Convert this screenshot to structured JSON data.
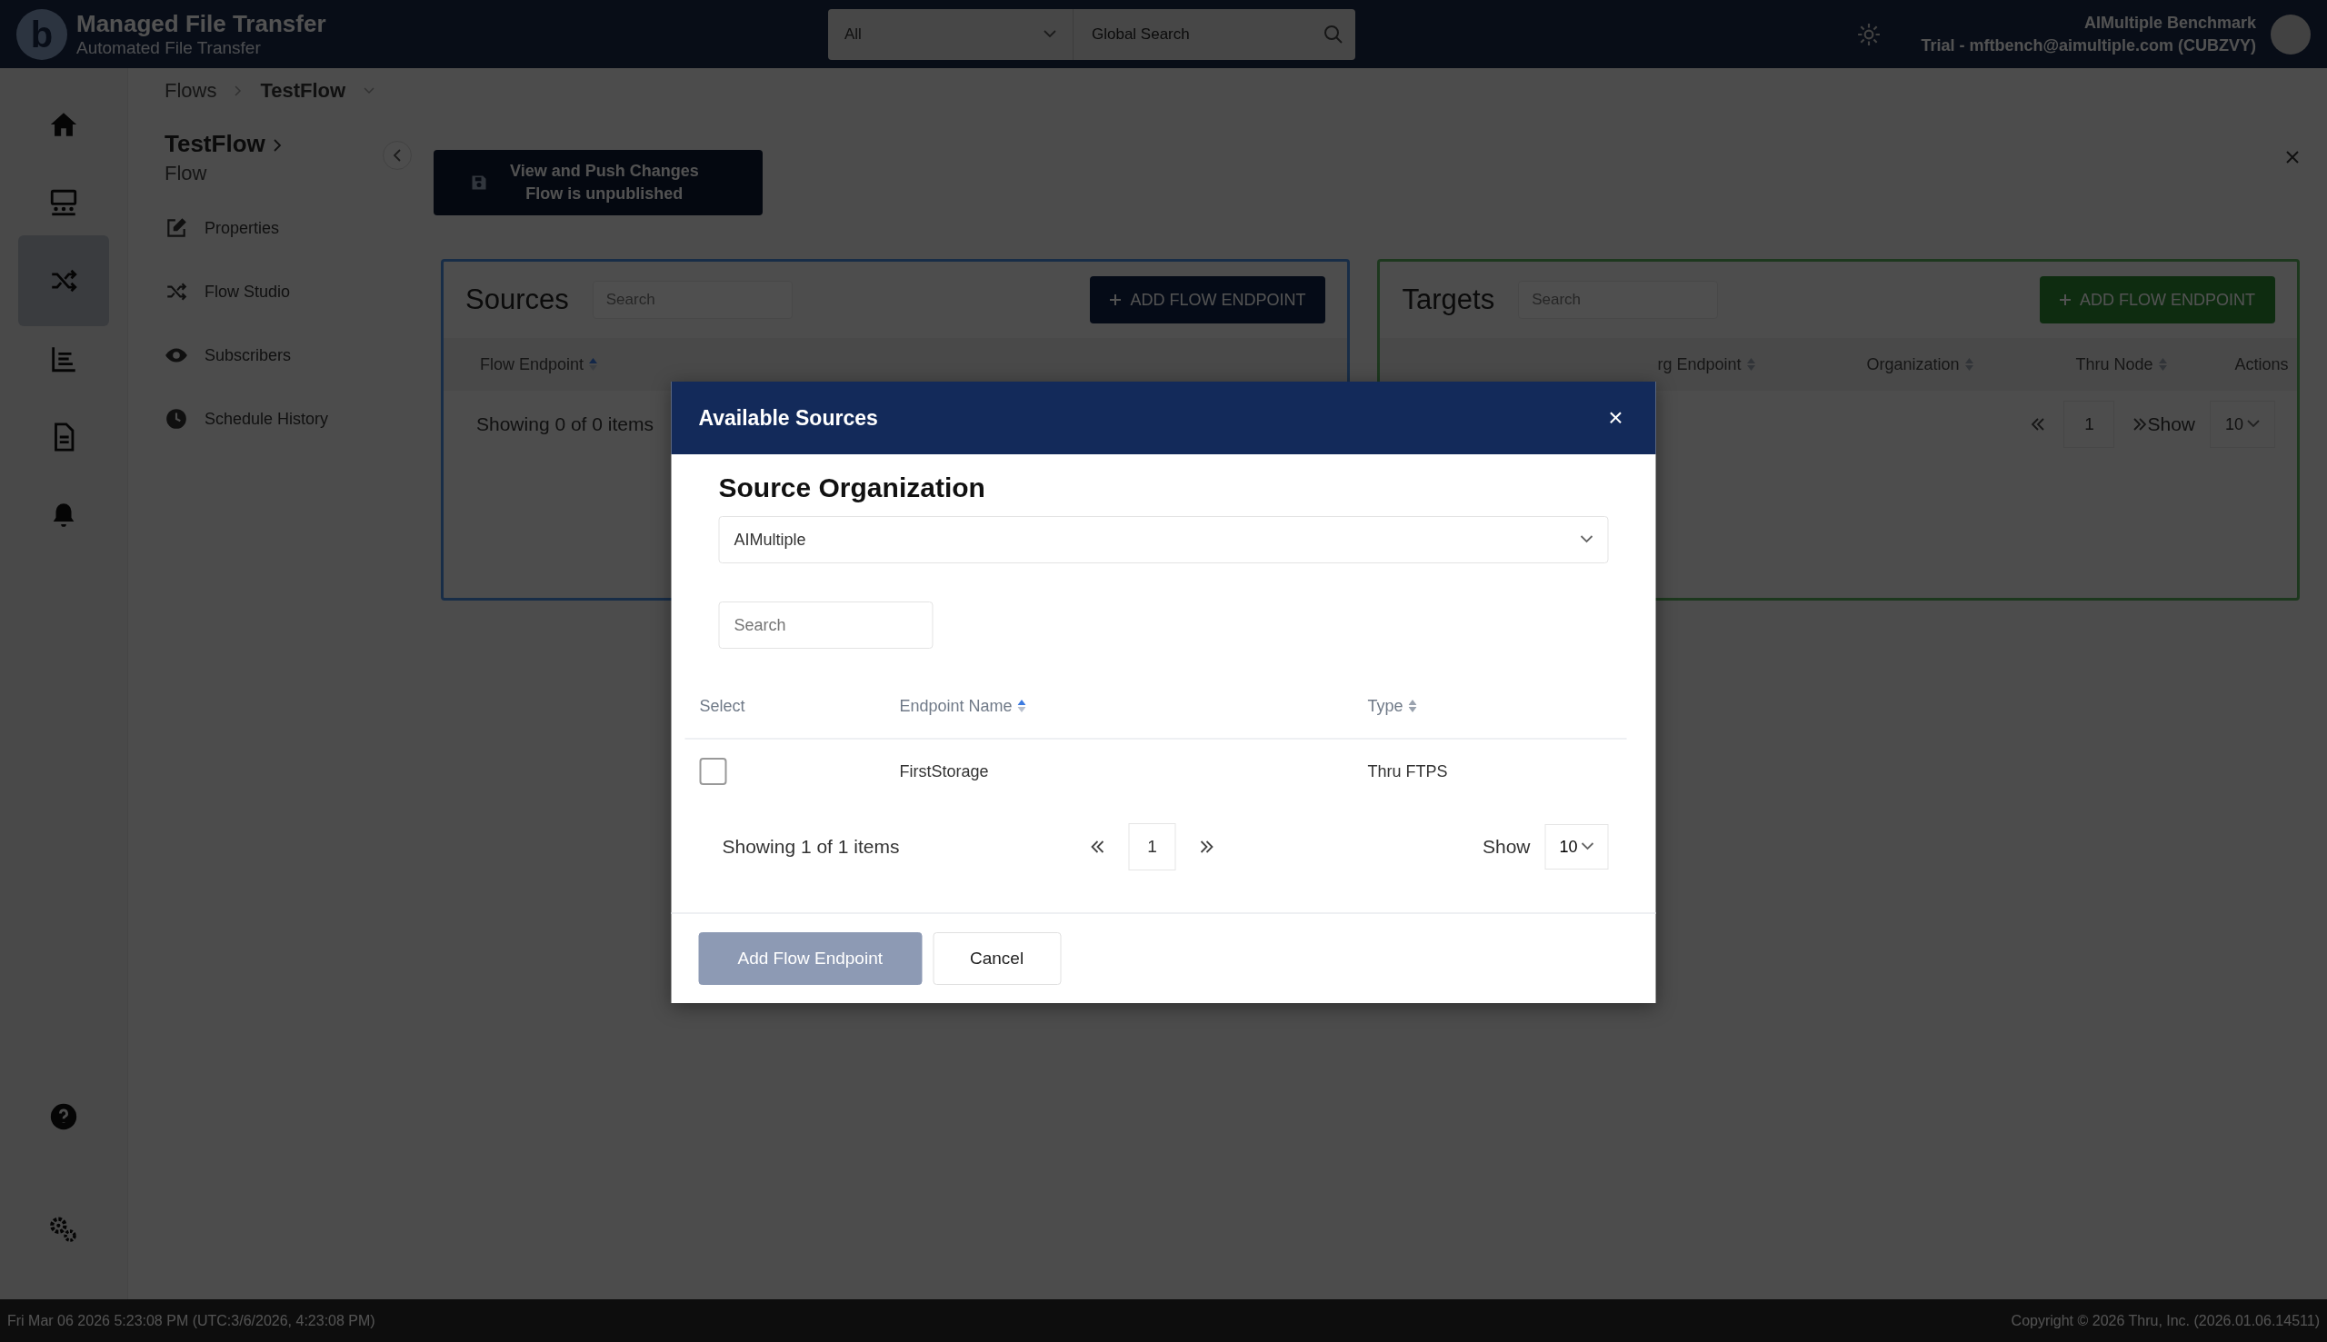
{
  "header": {
    "logo_letter": "b",
    "title": "Managed File Transfer",
    "subtitle": "Automated File Transfer",
    "scope_select": "All",
    "search": {
      "placeholder": "Global Search"
    },
    "user_name": "AIMultiple Benchmark",
    "user_account": "Trial - mftbench@aimultiple.com (CUBZVY)"
  },
  "rail": [
    {
      "selected": false
    },
    {
      "selected": false
    },
    {
      "selected": true
    },
    {
      "selected": false
    },
    {
      "selected": false
    },
    {
      "selected": false
    }
  ],
  "breadcrumb": [
    "Flows",
    "TestFlow"
  ],
  "flow": {
    "title": "TestFlow",
    "type": "Flow"
  },
  "subnav": [
    {
      "label": "Properties"
    },
    {
      "label": "Flow Studio"
    },
    {
      "label": "Subscribers"
    },
    {
      "label": "Schedule History"
    }
  ],
  "push_button": {
    "label": "View and Push Changes",
    "status": "Flow is unpublished"
  },
  "sources_panel": {
    "title": "Sources",
    "search": {
      "placeholder": "Search"
    },
    "add_button": "ADD FLOW ENDPOINT",
    "columns": [
      {
        "label": "Flow Endpoint",
        "sorted": true
      }
    ],
    "summary": "Showing 0 of 0 items"
  },
  "targets_panel": {
    "title": "Targets",
    "search": {
      "placeholder": "Search"
    },
    "add_button": "ADD FLOW ENDPOINT",
    "columns": [
      {
        "label": "rg Endpoint",
        "sorted": false
      },
      {
        "label": "Organization",
        "sorted": false
      },
      {
        "label": "Thru Node",
        "sorted": false
      },
      {
        "label": "Actions"
      }
    ],
    "page": "1",
    "show_label": "Show",
    "page_size": "10"
  },
  "dialog": {
    "title": "Available Sources",
    "close": "×",
    "org_label": "Source Organization",
    "org_value": "AIMultiple",
    "search": {
      "placeholder": "Search"
    },
    "columns": [
      {
        "label": "Select"
      },
      {
        "label": "Endpoint Name",
        "sorted": true
      },
      {
        "label": "Type",
        "sorted": false
      }
    ],
    "rows": [
      {
        "checked": false,
        "name": "FirstStorage",
        "type": "Thru FTPS"
      }
    ],
    "summary": "Showing 1 of 1 items",
    "page": "1",
    "show_label": "Show",
    "page_size": "10",
    "buttons": [
      {
        "label": "Add Flow Endpoint",
        "kind": "primary",
        "disabled": true
      },
      {
        "label": "Cancel",
        "kind": "secondary",
        "disabled": false
      }
    ]
  },
  "footer": {
    "timestamp": "Fri Mar 06 2026 5:23:08 PM (UTC:3/6/2026, 4:23:08 PM)",
    "copyright": "Copyright © 2026 Thru, Inc. (2026.01.06.14511)"
  }
}
